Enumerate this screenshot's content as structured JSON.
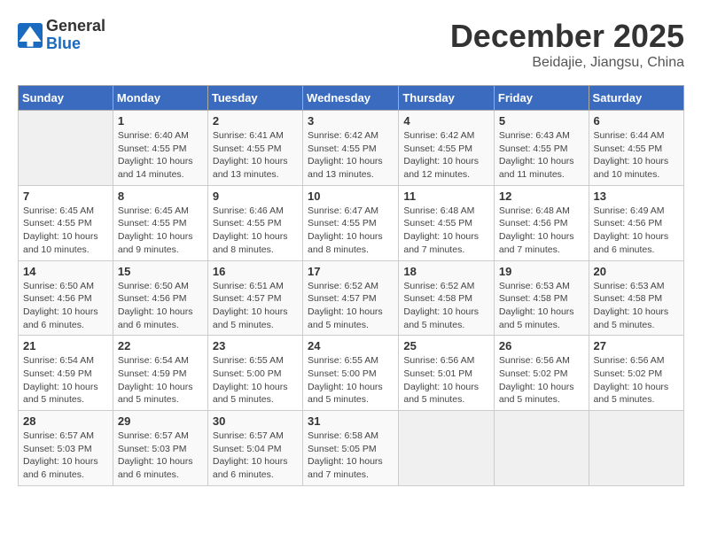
{
  "header": {
    "logo_general": "General",
    "logo_blue": "Blue",
    "month_title": "December 2025",
    "location": "Beidajie, Jiangsu, China"
  },
  "calendar": {
    "days_of_week": [
      "Sunday",
      "Monday",
      "Tuesday",
      "Wednesday",
      "Thursday",
      "Friday",
      "Saturday"
    ],
    "weeks": [
      [
        {
          "day": "",
          "detail": ""
        },
        {
          "day": "1",
          "detail": "Sunrise: 6:40 AM\nSunset: 4:55 PM\nDaylight: 10 hours\nand 14 minutes."
        },
        {
          "day": "2",
          "detail": "Sunrise: 6:41 AM\nSunset: 4:55 PM\nDaylight: 10 hours\nand 13 minutes."
        },
        {
          "day": "3",
          "detail": "Sunrise: 6:42 AM\nSunset: 4:55 PM\nDaylight: 10 hours\nand 13 minutes."
        },
        {
          "day": "4",
          "detail": "Sunrise: 6:42 AM\nSunset: 4:55 PM\nDaylight: 10 hours\nand 12 minutes."
        },
        {
          "day": "5",
          "detail": "Sunrise: 6:43 AM\nSunset: 4:55 PM\nDaylight: 10 hours\nand 11 minutes."
        },
        {
          "day": "6",
          "detail": "Sunrise: 6:44 AM\nSunset: 4:55 PM\nDaylight: 10 hours\nand 10 minutes."
        }
      ],
      [
        {
          "day": "7",
          "detail": "Sunrise: 6:45 AM\nSunset: 4:55 PM\nDaylight: 10 hours\nand 10 minutes."
        },
        {
          "day": "8",
          "detail": "Sunrise: 6:45 AM\nSunset: 4:55 PM\nDaylight: 10 hours\nand 9 minutes."
        },
        {
          "day": "9",
          "detail": "Sunrise: 6:46 AM\nSunset: 4:55 PM\nDaylight: 10 hours\nand 8 minutes."
        },
        {
          "day": "10",
          "detail": "Sunrise: 6:47 AM\nSunset: 4:55 PM\nDaylight: 10 hours\nand 8 minutes."
        },
        {
          "day": "11",
          "detail": "Sunrise: 6:48 AM\nSunset: 4:55 PM\nDaylight: 10 hours\nand 7 minutes."
        },
        {
          "day": "12",
          "detail": "Sunrise: 6:48 AM\nSunset: 4:56 PM\nDaylight: 10 hours\nand 7 minutes."
        },
        {
          "day": "13",
          "detail": "Sunrise: 6:49 AM\nSunset: 4:56 PM\nDaylight: 10 hours\nand 6 minutes."
        }
      ],
      [
        {
          "day": "14",
          "detail": "Sunrise: 6:50 AM\nSunset: 4:56 PM\nDaylight: 10 hours\nand 6 minutes."
        },
        {
          "day": "15",
          "detail": "Sunrise: 6:50 AM\nSunset: 4:56 PM\nDaylight: 10 hours\nand 6 minutes."
        },
        {
          "day": "16",
          "detail": "Sunrise: 6:51 AM\nSunset: 4:57 PM\nDaylight: 10 hours\nand 5 minutes."
        },
        {
          "day": "17",
          "detail": "Sunrise: 6:52 AM\nSunset: 4:57 PM\nDaylight: 10 hours\nand 5 minutes."
        },
        {
          "day": "18",
          "detail": "Sunrise: 6:52 AM\nSunset: 4:58 PM\nDaylight: 10 hours\nand 5 minutes."
        },
        {
          "day": "19",
          "detail": "Sunrise: 6:53 AM\nSunset: 4:58 PM\nDaylight: 10 hours\nand 5 minutes."
        },
        {
          "day": "20",
          "detail": "Sunrise: 6:53 AM\nSunset: 4:58 PM\nDaylight: 10 hours\nand 5 minutes."
        }
      ],
      [
        {
          "day": "21",
          "detail": "Sunrise: 6:54 AM\nSunset: 4:59 PM\nDaylight: 10 hours\nand 5 minutes."
        },
        {
          "day": "22",
          "detail": "Sunrise: 6:54 AM\nSunset: 4:59 PM\nDaylight: 10 hours\nand 5 minutes."
        },
        {
          "day": "23",
          "detail": "Sunrise: 6:55 AM\nSunset: 5:00 PM\nDaylight: 10 hours\nand 5 minutes."
        },
        {
          "day": "24",
          "detail": "Sunrise: 6:55 AM\nSunset: 5:00 PM\nDaylight: 10 hours\nand 5 minutes."
        },
        {
          "day": "25",
          "detail": "Sunrise: 6:56 AM\nSunset: 5:01 PM\nDaylight: 10 hours\nand 5 minutes."
        },
        {
          "day": "26",
          "detail": "Sunrise: 6:56 AM\nSunset: 5:02 PM\nDaylight: 10 hours\nand 5 minutes."
        },
        {
          "day": "27",
          "detail": "Sunrise: 6:56 AM\nSunset: 5:02 PM\nDaylight: 10 hours\nand 5 minutes."
        }
      ],
      [
        {
          "day": "28",
          "detail": "Sunrise: 6:57 AM\nSunset: 5:03 PM\nDaylight: 10 hours\nand 6 minutes."
        },
        {
          "day": "29",
          "detail": "Sunrise: 6:57 AM\nSunset: 5:03 PM\nDaylight: 10 hours\nand 6 minutes."
        },
        {
          "day": "30",
          "detail": "Sunrise: 6:57 AM\nSunset: 5:04 PM\nDaylight: 10 hours\nand 6 minutes."
        },
        {
          "day": "31",
          "detail": "Sunrise: 6:58 AM\nSunset: 5:05 PM\nDaylight: 10 hours\nand 7 minutes."
        },
        {
          "day": "",
          "detail": ""
        },
        {
          "day": "",
          "detail": ""
        },
        {
          "day": "",
          "detail": ""
        }
      ]
    ]
  }
}
